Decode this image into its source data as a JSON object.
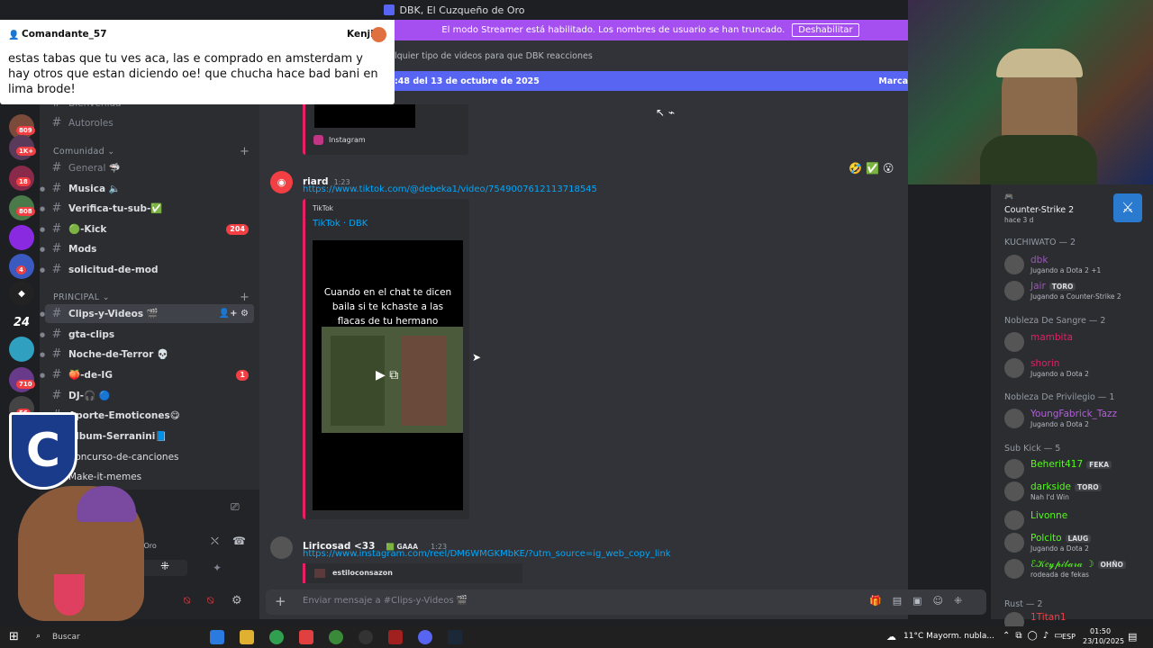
{
  "window": {
    "title": "DBK, El Cuzqueño de Oro"
  },
  "popup": {
    "user": "Comandante_57",
    "user2": "Kenji",
    "text": "estas tabas que tu ves aca, las e comprado en amsterdam y hay otros que estan diciendo oe! que chucha hace bad bani en lima brode!"
  },
  "streamer_bar": {
    "text": "El modo Streamer está habilitado. Los nombres de usuario se han truncado.",
    "button": "Deshabilitar"
  },
  "topic": "lquier tipo de videos para que DBK reacciones",
  "banner": {
    "left": ":48 del 13 de octubre de 2025",
    "right": "Marca"
  },
  "guild_badges": [
    "809",
    "1K+",
    "18",
    "808",
    "4",
    "710",
    "56"
  ],
  "guild_text": [
    "24"
  ],
  "channels": {
    "top_items": [
      {
        "label": "Bienvenida",
        "muted": true
      },
      {
        "label": "Autoroles",
        "muted": true
      }
    ],
    "cat1": "Comunidad",
    "cat1_items": [
      {
        "label": "General",
        "suffix": "🦈",
        "muted": true
      },
      {
        "label": "Musica",
        "suffix": "🔈",
        "muted": false
      },
      {
        "label": "Verifica-tu-sub-",
        "suffix": "✅",
        "muted": false
      },
      {
        "label": "🟢-Kick",
        "suffix": "",
        "muted": false,
        "badge": "204"
      },
      {
        "label": "Mods",
        "suffix": "",
        "muted": false
      },
      {
        "label": "solicitud-de-mod",
        "suffix": "",
        "muted": false
      }
    ],
    "cat2": "PRINCIPAL",
    "cat2_items": [
      {
        "label": "Clips-y-Videos",
        "suffix": "🎬",
        "selected": true
      },
      {
        "label": "gta-clips",
        "suffix": ""
      },
      {
        "label": "Noche-de-Terror",
        "suffix": "💀"
      },
      {
        "label": "🍑-de-IG",
        "suffix": "",
        "badge": "1"
      },
      {
        "label": "DJ-🎧",
        "suffix": "🔵"
      },
      {
        "label": "Aporte-Emoticones",
        "suffix": "😋"
      },
      {
        "label": "Album-Serranini",
        "suffix": "📘"
      },
      {
        "label": "Concurso-de-canciones",
        "suffix": ""
      },
      {
        "label": "Make-it-memes",
        "suffix": ""
      }
    ]
  },
  "user_panel": {
    "status": "o Oro"
  },
  "messages": [
    {
      "source": "Instagram"
    },
    {
      "author": "riard",
      "time": "1:23",
      "link": "https://www.tiktok.com/@debeka1/video/7549007612113718545",
      "provider": "TikTok",
      "embed_title": "TikTok · DBK",
      "video_caption": "Cuando en el chat te dicen baila si te kchaste a las flacas de tu hermano"
    },
    {
      "author": "Liricosad <33",
      "tag": "GAAA",
      "time": "1:23",
      "link": "https://www.instagram.com/reel/DM6WMGKMbKE/?utm_source=ig_web_copy_link",
      "embed_author": "estiloconsazon"
    }
  ],
  "reactions": [
    "🤣",
    "✅",
    "😮"
  ],
  "input_placeholder": "Enviar mensaje a #Clips-y-Videos 🎬",
  "members": {
    "top_activity": {
      "title": "Counter-Strike 2",
      "sub": "hace 3 d"
    },
    "groups": [
      {
        "name": "KUCHIWATO — 2",
        "members": [
          {
            "name": "dbk",
            "status": "Jugando a Dota 2 +1",
            "color": "#9b59b6",
            "tag": ""
          },
          {
            "name": "Jair",
            "status": "Jugando a Counter-Strike 2",
            "color": "#9b59b6",
            "tag": "TORO"
          }
        ]
      },
      {
        "name": "Nobleza De Sangre — 2",
        "members": [
          {
            "name": "mambita",
            "status": "",
            "color": "#e91e63",
            "tag": ""
          },
          {
            "name": "shorin",
            "status": "Jugando a Dota 2",
            "color": "#e91e63",
            "tag": ""
          }
        ]
      },
      {
        "name": "Nobleza De Privilegio — 1",
        "members": [
          {
            "name": "YoungFabrick_Tazz",
            "status": "Jugando a Dota 2",
            "color": "#b45fdc",
            "tag": ""
          }
        ]
      },
      {
        "name": "Sub Kick — 5",
        "members": [
          {
            "name": "Beherit417",
            "status": "",
            "color": "#53fc18",
            "tag": "FEKA"
          },
          {
            "name": "darkside",
            "status": "Nah I'd Win",
            "color": "#53fc18",
            "tag": "TORO"
          },
          {
            "name": "Livonne",
            "status": "",
            "color": "#53fc18",
            "tag": ""
          },
          {
            "name": "Polcito",
            "status": "Jugando a Dota 2",
            "color": "#53fc18",
            "tag": "LAUG"
          },
          {
            "name": "ℰ𝒦𝑒𝓎𝓅𝒾𝒷𝒶𝓇𝒶 ☽",
            "status": "rodeada de fekas",
            "color": "#53fc18",
            "tag": "OHÑO"
          }
        ]
      },
      {
        "name": "Rust — 2",
        "members": [
          {
            "name": "1Titan1",
            "status": "",
            "color": "#f23f43",
            "tag": ""
          }
        ]
      }
    ]
  },
  "taskbar": {
    "search": "Buscar",
    "weather": "11°C  Mayorm. nubla...",
    "lang": "ESP",
    "time": "01:50",
    "date": "23/10/2025"
  }
}
